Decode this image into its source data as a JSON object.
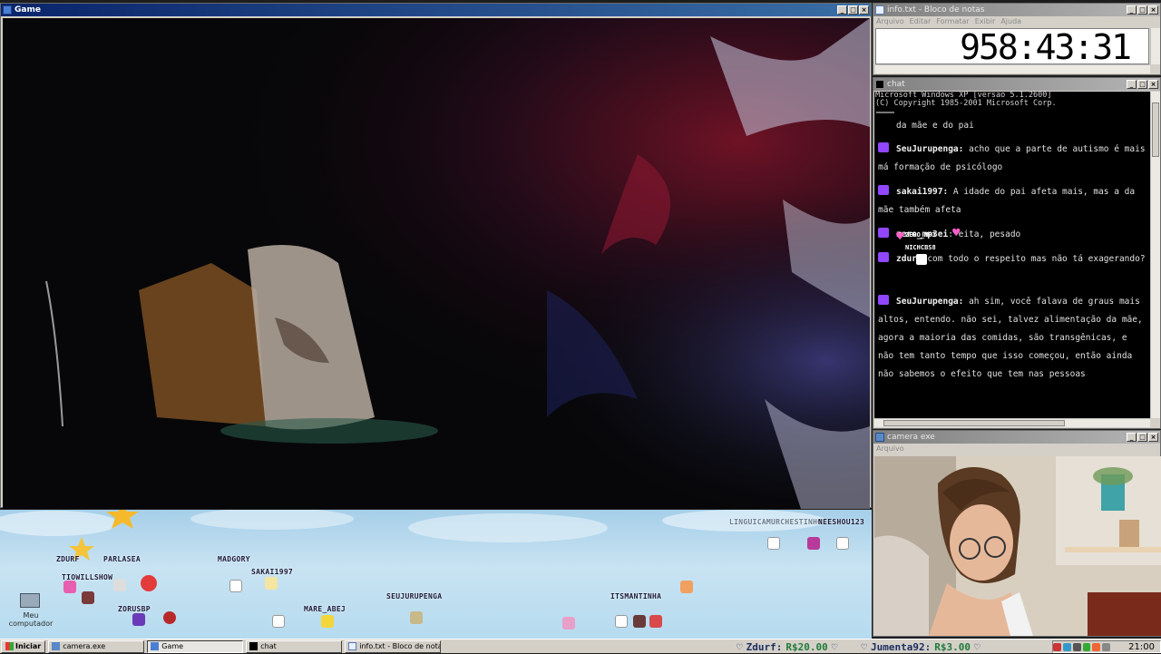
{
  "game_window": {
    "title": "Game",
    "buttons": [
      "_",
      "□",
      "×"
    ]
  },
  "stage": {
    "usernames": [
      {
        "name": "ZDURF"
      },
      {
        "name": "PARLASEA"
      },
      {
        "name": "TIOWILLSHOW"
      },
      {
        "name": "ZORUSBP"
      },
      {
        "name": "MADGORY"
      },
      {
        "name": "SAKAI1997"
      },
      {
        "name": "MARE_ABEJ"
      },
      {
        "name": "SEUJURUPENGA"
      },
      {
        "name": "ITSMANTINHA"
      },
      {
        "name": "LINGUICAMURCHESTINHO"
      },
      {
        "name": "NEESHOU123"
      }
    ],
    "desktop_icon_label": "Meu computador"
  },
  "notepad": {
    "title": "info.txt - Bloco de notas",
    "menu": [
      "Arquivo",
      "Editar",
      "Formatar",
      "Exibir",
      "Ajuda"
    ],
    "timer": "958:43:31"
  },
  "chat": {
    "title": "chat",
    "header_line1": "Microsoft Windows XP [versão 5.1.2600]",
    "header_line2": "(C) Copyright 1985-2001 Microsoft Corp.",
    "messages": [
      {
        "user": "",
        "text": "da mãe e do pai"
      },
      {
        "user": "SeuJurupenga:",
        "text": " acho que a parte de autismo é mais má formação de psicólogo"
      },
      {
        "user": "sakai1997:",
        "text": " A idade do pai afeta mais, mas a da mãe também afeta"
      },
      {
        "user": "zero_mp3ei",
        "text": ": eita, pesado"
      },
      {
        "user": "zdurf",
        "text": " com todo o respeito mas não tá exagerando?"
      },
      {
        "user": "SeuJurupenga:",
        "text": " ah sim, você falava de graus mais altos, entendo. não sei, talvez alimentação da mãe, agora a maioria das comidas, são transgênicas, e não tem tanto tempo que isso começou, então ainda não sabemos o efeito que tem nas pessoas"
      }
    ],
    "overlay_names": [
      "ZERO_MP3",
      "NICHCBS8"
    ]
  },
  "camera": {
    "title": "camera exe",
    "menu": "Arquivo"
  },
  "taskbar": {
    "start_label": "Iniciar",
    "tasks": [
      {
        "label": "camera.exe"
      },
      {
        "label": "Game"
      },
      {
        "label": "chat"
      },
      {
        "label": "info.txt - Bloco de notas"
      }
    ],
    "donations": [
      {
        "user": "Zdurf:",
        "amount": "R$20.00"
      },
      {
        "user": "Jumenta92:",
        "amount": "R$3.00"
      }
    ],
    "clock": "21:00"
  },
  "colors": {
    "title_active": "#0a246a",
    "title_inactive": "#808080",
    "twitch": "#9146ff",
    "donation_amount": "#1f7a3a"
  }
}
